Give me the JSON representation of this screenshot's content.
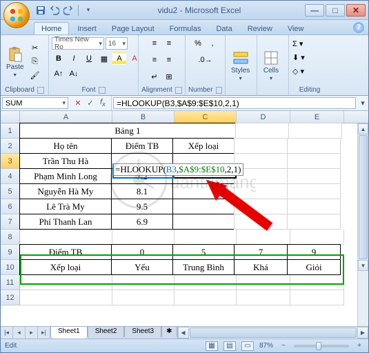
{
  "window": {
    "title": "vidu2 - Microsoft Excel"
  },
  "qat": {
    "save": "save-icon",
    "undo": "undo-icon",
    "redo": "redo-icon"
  },
  "tabs": [
    "Home",
    "Insert",
    "Page Layout",
    "Formulas",
    "Data",
    "Review",
    "View"
  ],
  "ribbon": {
    "clipboard": {
      "label": "Clipboard",
      "paste": "Paste"
    },
    "font": {
      "label": "Font",
      "name": "Times New Ro",
      "size": "16"
    },
    "alignment": {
      "label": "Alignment"
    },
    "number": {
      "label": "Number"
    },
    "styles": {
      "label": "Styles"
    },
    "cells": {
      "label": "Cells"
    },
    "editing": {
      "label": "Editing"
    }
  },
  "namebox": "SUM",
  "formula_bar": "=HLOOKUP(B3,$A$9:$E$10,2,1)",
  "columns": [
    "A",
    "B",
    "C",
    "D",
    "E"
  ],
  "rownums": [
    "1",
    "2",
    "3",
    "4",
    "5",
    "6",
    "7",
    "8",
    "9",
    "10",
    "11",
    "12"
  ],
  "cells": {
    "A1": "Bảng 1",
    "A2": "Họ tên",
    "B2": "Điểm TB",
    "C2": "Xếp loại",
    "A3": "Trần Thu Hà",
    "A4": "Phạm Minh Long",
    "B4": "7.2",
    "A5": "Nguyễn Hà My",
    "B5": "8.1",
    "A6": "Lê Trà My",
    "B6": "9.5",
    "A7": "Phí Thanh Lan",
    "B7": "6.9",
    "A9": "Điểm TB",
    "B9": "0",
    "C9": "5",
    "D9": "7",
    "E9": "9",
    "A10": "Xếp loại",
    "B10": "Yếu",
    "C10": "Trung Bình",
    "D10": "Khá",
    "E10": "Giỏi"
  },
  "formula_edit": {
    "fn": "=HLOOKUP(",
    "ref1": "B3",
    "c1": ",",
    "ref2": "$A$9:$E$10",
    "c2": ",2,1)"
  },
  "sheets": [
    "Sheet1",
    "Sheet2",
    "Sheet3"
  ],
  "status": {
    "mode": "Edit",
    "zoom": "87%"
  },
  "watermark": "Quantrimang"
}
